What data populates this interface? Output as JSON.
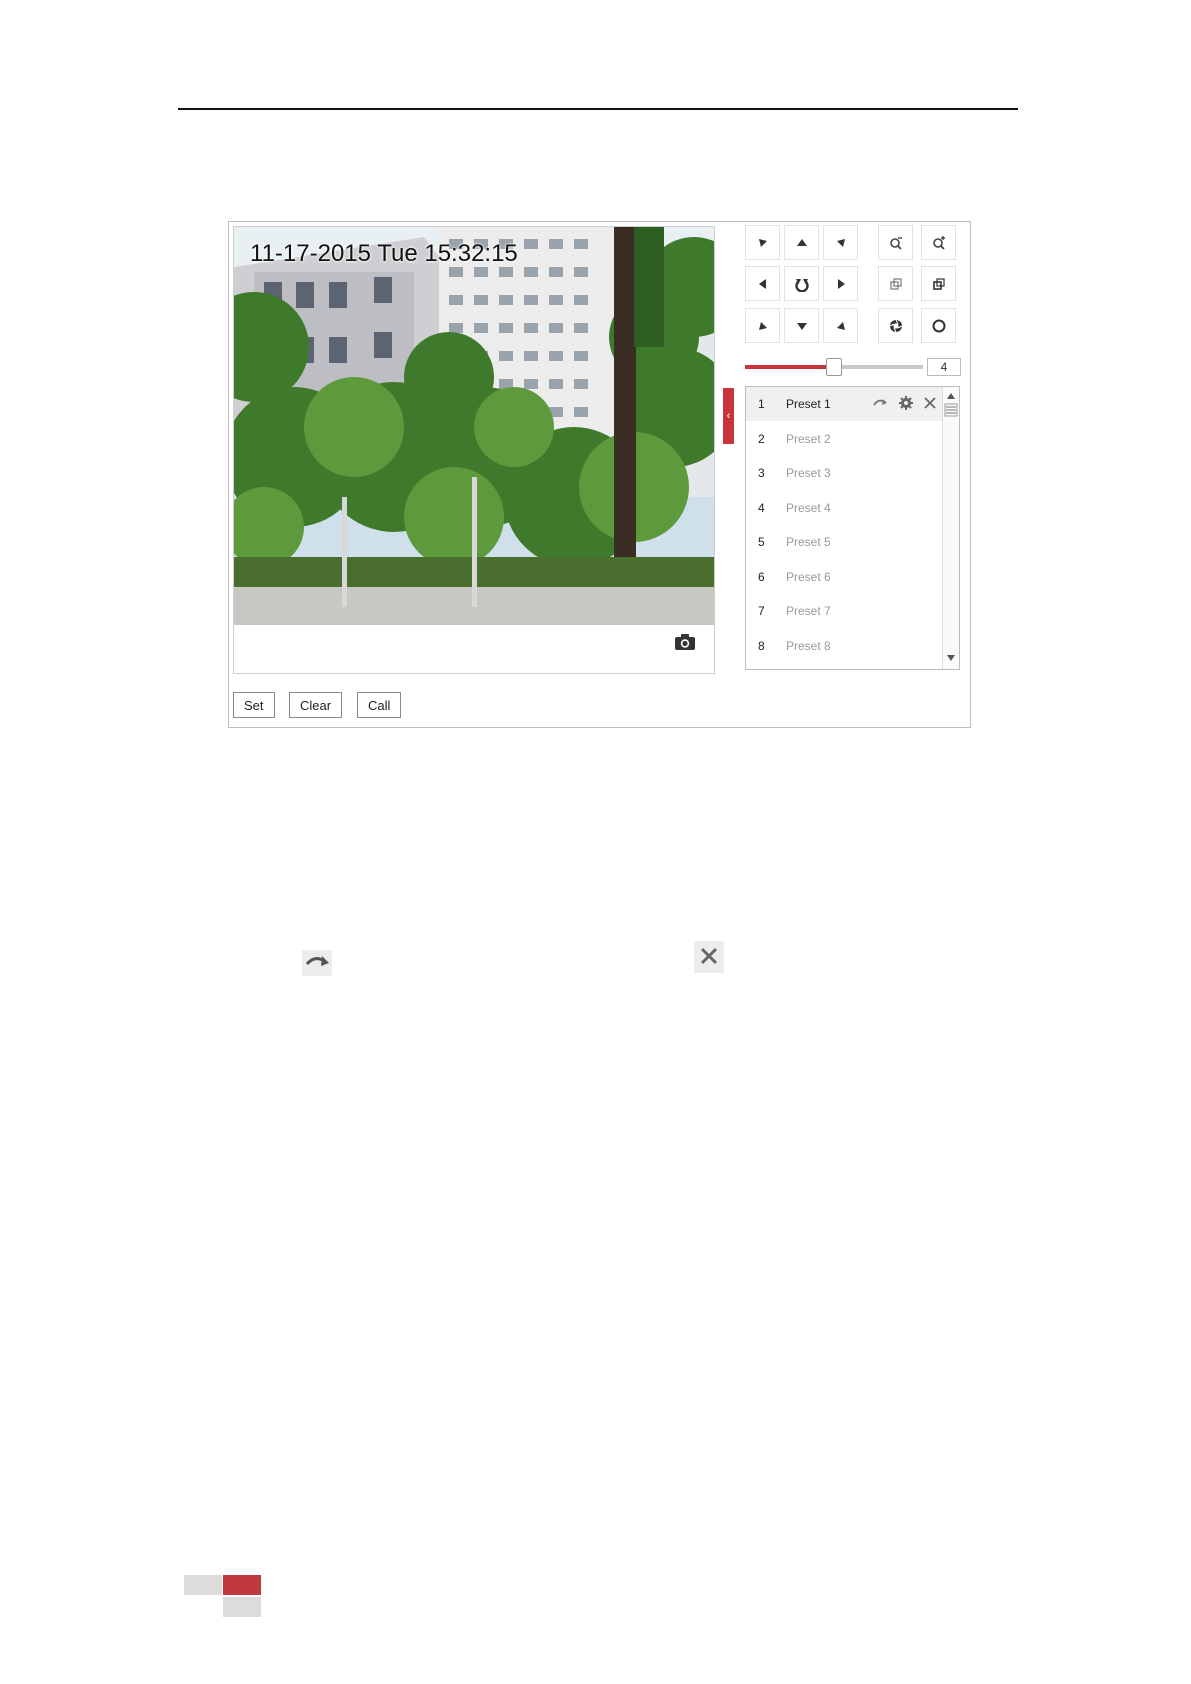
{
  "camera": {
    "osd_timestamp": "11-17-2015 Tue 15:32:15"
  },
  "ptz": {
    "speed_value": "4",
    "speed_level": 0.5,
    "buttons": [
      {
        "name": "pan-up-left-button",
        "icon": "arrow-up-left-icon"
      },
      {
        "name": "pan-up-button",
        "icon": "arrow-up-icon"
      },
      {
        "name": "pan-up-right-button",
        "icon": "arrow-up-right-icon"
      },
      {
        "name": "zoom-out-button",
        "icon": "zoom-out-icon"
      },
      {
        "name": "zoom-in-button",
        "icon": "zoom-in-icon"
      },
      {
        "name": "pan-left-button",
        "icon": "arrow-left-icon"
      },
      {
        "name": "auto-pan-button",
        "icon": "rotate-icon"
      },
      {
        "name": "pan-right-button",
        "icon": "arrow-right-icon"
      },
      {
        "name": "focus-near-button",
        "icon": "focus-near-icon"
      },
      {
        "name": "focus-far-button",
        "icon": "focus-far-icon"
      },
      {
        "name": "pan-down-left-button",
        "icon": "arrow-down-left-icon"
      },
      {
        "name": "pan-down-button",
        "icon": "arrow-down-icon"
      },
      {
        "name": "pan-down-right-button",
        "icon": "arrow-down-right-icon"
      },
      {
        "name": "iris-open-button",
        "icon": "iris-open-icon"
      },
      {
        "name": "iris-close-button",
        "icon": "iris-close-icon"
      }
    ]
  },
  "presets": [
    {
      "num": "1",
      "name": "Preset 1"
    },
    {
      "num": "2",
      "name": "Preset 2"
    },
    {
      "num": "3",
      "name": "Preset 3"
    },
    {
      "num": "4",
      "name": "Preset 4"
    },
    {
      "num": "5",
      "name": "Preset 5"
    },
    {
      "num": "6",
      "name": "Preset 6"
    },
    {
      "num": "7",
      "name": "Preset 7"
    },
    {
      "num": "8",
      "name": "Preset 8"
    }
  ],
  "actions": {
    "set_label": "Set",
    "clear_label": "Clear",
    "call_label": "Call"
  },
  "colors": {
    "accent": "#c8343a",
    "footer_gray": "#dcdcdc"
  }
}
